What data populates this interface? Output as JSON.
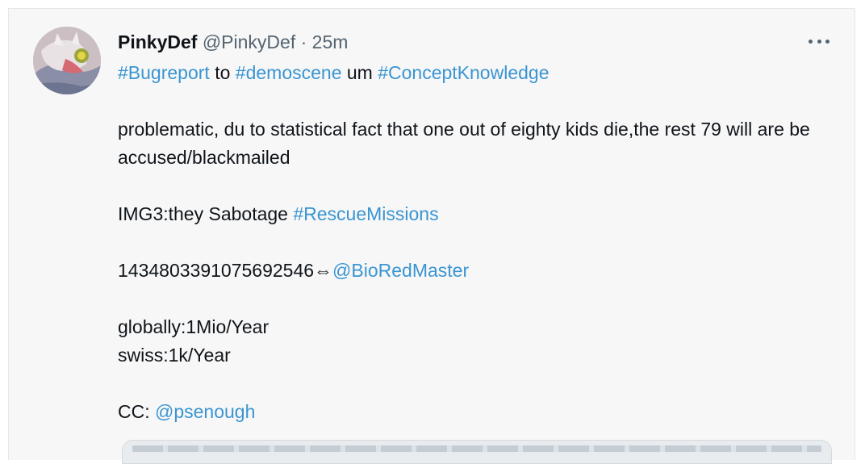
{
  "tweet": {
    "author": {
      "display_name": "PinkyDef",
      "handle": "@PinkyDef",
      "separator": "·",
      "timestamp": "25m"
    },
    "line1": {
      "tag1": "#Bugreport",
      "word1": " to ",
      "tag2": "#demoscene",
      "word2": " um ",
      "tag3": "#ConceptKnowledge"
    },
    "paragraph1": "problematic, du to statistical fact that one out of eighty kids die,the rest 79 will are be accused/blackmailed",
    "img3": {
      "prefix": "IMG3:they Sabotage ",
      "tag": "#RescueMissions"
    },
    "id_line": {
      "number": "1434803391075692546⇔",
      "mention": "@BioRedMaster"
    },
    "stat1": "globally:1Mio/Year",
    "stat2": "swiss:1k/Year",
    "cc": {
      "prefix": "CC: ",
      "mention": "@psenough"
    }
  },
  "icons": {
    "more": "more-horizontal-icon",
    "avatar": "avatar-image"
  },
  "colors": {
    "link": "#3a95d2",
    "secondary_text": "#536471",
    "card_background": "#f7f7f7"
  }
}
